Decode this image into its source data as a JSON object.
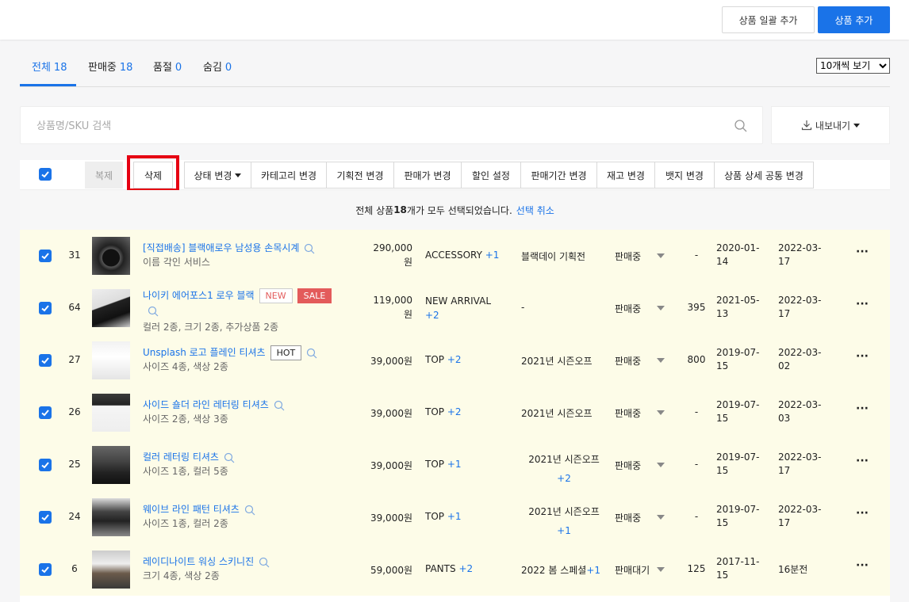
{
  "header": {
    "bulk_add_label": "상품 일괄 추가",
    "add_label": "상품 추가"
  },
  "tabs": [
    {
      "label": "전체",
      "count": "18"
    },
    {
      "label": "판매중",
      "count": "18"
    },
    {
      "label": "품절",
      "count": "0"
    },
    {
      "label": "숨김",
      "count": "0"
    }
  ],
  "view_select": {
    "selected": "10개씩 보기"
  },
  "search": {
    "placeholder": "상품명/SKU 검색",
    "value": ""
  },
  "export": {
    "label": "내보내기"
  },
  "toolbar": {
    "copy_label": "복제",
    "delete_label": "삭제",
    "status_label": "상태 변경",
    "category_label": "카테고리 변경",
    "promotion_label": "기획전 변경",
    "price_label": "판매가 변경",
    "discount_label": "할인 설정",
    "period_label": "판매기간 변경",
    "stock_label": "재고 변경",
    "badge_label": "뱃지 변경",
    "detail_label": "상품 상세 공통 변경"
  },
  "selection": {
    "prefix": "전체 상품 ",
    "count": "18",
    "suffix": "개가 모두 선택되었습니다.",
    "cancel": "선택 취소"
  },
  "accent_color": "#1a73e8",
  "highlight_color": "#e60012",
  "products": [
    {
      "num": "31",
      "name": "[직접배송] 블랙애로우 남성용 손목시계",
      "badges": [],
      "sub": "이름 각인 서비스",
      "price": "290,000원",
      "category": "ACCESSORY",
      "category_plus": "+1",
      "promo": "블랙데이 기획전",
      "promo_plus": "",
      "status": "판매중",
      "stock": "-",
      "date1": "2020-01-14",
      "date2": "2022-03-17"
    },
    {
      "num": "64",
      "name": "나이키 에어포스1 로우 블랙",
      "badges": [
        "NEW",
        "SALE"
      ],
      "sub": "컬러 2종, 크기 2종, 추가상품 2종",
      "price": "119,000원",
      "category": "NEW ARRIVAL",
      "category_plus": "+2",
      "promo": "-",
      "promo_plus": "",
      "status": "판매중",
      "stock": "395",
      "date1": "2021-05-13",
      "date2": "2022-03-17"
    },
    {
      "num": "27",
      "name": "Unsplash 로고 플레인 티셔츠",
      "badges": [
        "HOT"
      ],
      "sub": "사이즈 4종, 색상 2종",
      "price": "39,000원",
      "category": "TOP",
      "category_plus": "+2",
      "promo": "2021년 시즌오프",
      "promo_plus": "",
      "status": "판매중",
      "stock": "800",
      "date1": "2019-07-15",
      "date2": "2022-03-02"
    },
    {
      "num": "26",
      "name": "사이드 숄더 라인 레터링 티셔츠",
      "badges": [],
      "sub": "사이즈 2종, 색상 3종",
      "price": "39,000원",
      "category": "TOP",
      "category_plus": "+2",
      "promo": "2021년 시즌오프",
      "promo_plus": "",
      "status": "판매중",
      "stock": "-",
      "date1": "2019-07-15",
      "date2": "2022-03-03"
    },
    {
      "num": "25",
      "name": "컬러 레터링 티셔츠",
      "badges": [],
      "sub": "사이즈 1종, 컬러 5종",
      "price": "39,000원",
      "category": "TOP",
      "category_plus": "+1",
      "promo": "2021년 시즌오프",
      "promo_plus": "+2",
      "status": "판매중",
      "stock": "-",
      "date1": "2019-07-15",
      "date2": "2022-03-17"
    },
    {
      "num": "24",
      "name": "웨이브 라인 패턴 티셔츠",
      "badges": [],
      "sub": "사이즈 1종, 컬러 2종",
      "price": "39,000원",
      "category": "TOP",
      "category_plus": "+1",
      "promo": "2021년 시즌오프",
      "promo_plus": "+1",
      "status": "판매중",
      "stock": "-",
      "date1": "2019-07-15",
      "date2": "2022-03-17"
    },
    {
      "num": "6",
      "name": "레이디나이트 워싱 스키니진",
      "badges": [],
      "sub": "크기 4종, 색상 2종",
      "price": "59,000원",
      "category": "PANTS",
      "category_plus": "+2",
      "promo": "2022 봄 스페셜",
      "promo_plus": "+1",
      "status": "판매대기",
      "stock": "125",
      "date1": "2017-11-15",
      "date2": "16분전"
    }
  ]
}
